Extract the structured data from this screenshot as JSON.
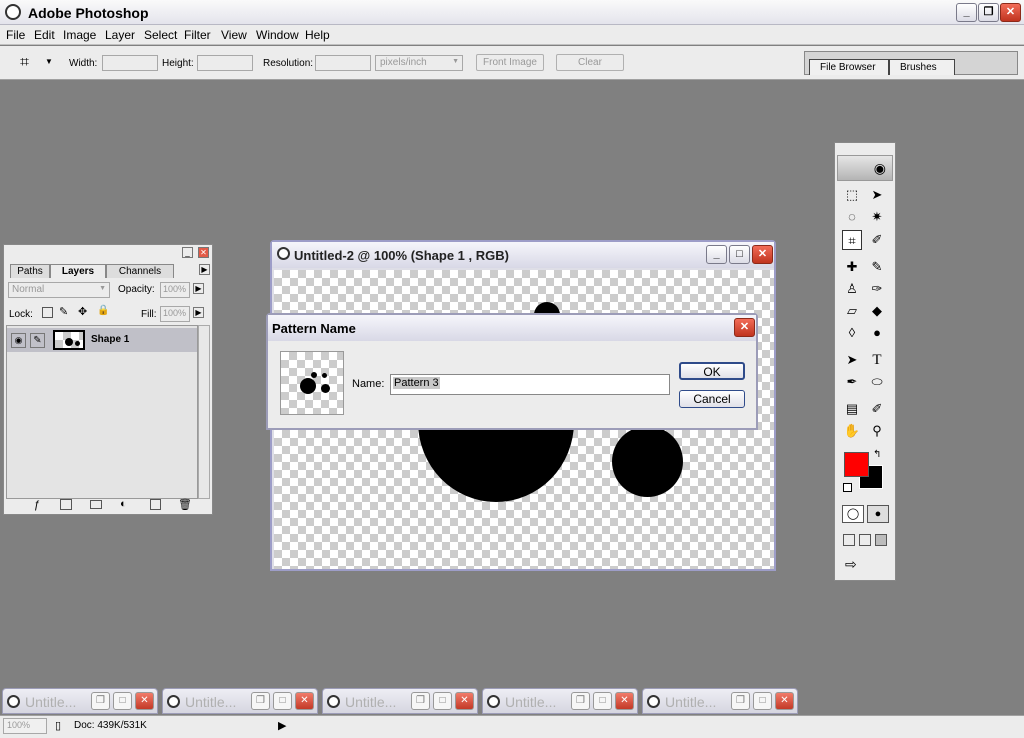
{
  "app": {
    "title": "Adobe Photoshop"
  },
  "menu": [
    "File",
    "Edit",
    "Image",
    "Layer",
    "Select",
    "Filter",
    "View",
    "Window",
    "Help"
  ],
  "options": {
    "width_label": "Width:",
    "height_label": "Height:",
    "resolution_label": "Resolution:",
    "units": "pixels/inch",
    "front_image": "Front Image",
    "clear": "Clear"
  },
  "palette_well": {
    "tabs": [
      "File Browser",
      "Brushes"
    ]
  },
  "layers_panel": {
    "tabs": [
      "Paths",
      "Layers",
      "Channels"
    ],
    "blend_mode": "Normal",
    "opacity_label": "Opacity:",
    "opacity_value": "100%",
    "lock_label": "Lock:",
    "fill_label": "Fill:",
    "fill_value": "100%",
    "layer_name": "Shape 1"
  },
  "document": {
    "title": "Untitled-2 @ 100% (Shape 1 , RGB)"
  },
  "dialog": {
    "title": "Pattern Name",
    "name_label": "Name:",
    "name_value": "Pattern 3",
    "ok": "OK",
    "cancel": "Cancel"
  },
  "colors": {
    "foreground": "#ff0000",
    "background": "#000000"
  },
  "taskbar": {
    "items": [
      "Untitle...",
      "Untitle...",
      "Untitle...",
      "Untitle...",
      "Untitle..."
    ]
  },
  "status": {
    "zoom": "100%",
    "doc": "Doc: 439K/531K"
  }
}
